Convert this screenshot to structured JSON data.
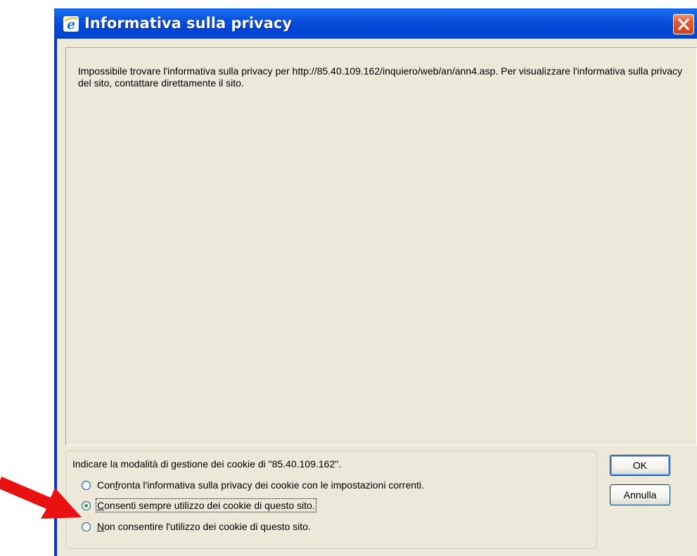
{
  "window": {
    "title": "Informativa sulla privacy",
    "icons": {
      "app": "internet-explorer-icon",
      "close": "close-icon"
    }
  },
  "content": {
    "message": "Impossibile trovare l'informativa sulla privacy per http://85.40.109.162/inquiero/web/an/ann4.asp. Per visualizzare l'informativa sulla privacy del sito, contattare direttamente il sito."
  },
  "cookies": {
    "prompt": "Indicare la modalità di gestione dei cookie di \"85.40.109.162\".",
    "options": [
      {
        "label": "Confronta l'informativa sulla privacy dei cookie con le impostazioni correnti.",
        "selected": false
      },
      {
        "label": "Consenti sempre utilizzo dei cookie di questo sito.",
        "selected": true
      },
      {
        "label": "Non consentire l'utilizzo dei cookie di questo sito.",
        "selected": false
      }
    ]
  },
  "buttons": {
    "ok": "OK",
    "cancel": "Annulla"
  },
  "annotation": {
    "icon": "red-arrow-icon",
    "color": "#e81010"
  },
  "colors": {
    "titlebar": "#0a54de",
    "client": "#ece9d8",
    "close": "#e35a31",
    "radio_dot": "#2fa53b"
  }
}
